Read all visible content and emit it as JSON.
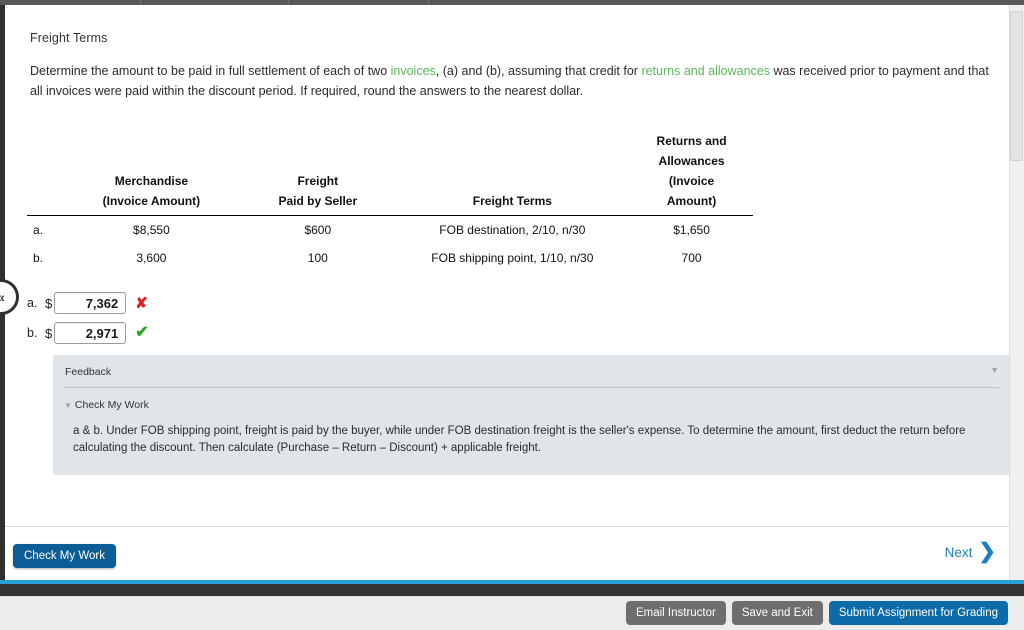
{
  "chrome": {
    "collapse_handle_icon": "chevron-left-double",
    "collapse_handle_glyph": "«"
  },
  "question": {
    "title": "Freight Terms",
    "body_part1": "Determine the amount to be paid in full settlement of each of two ",
    "link1": "invoices",
    "body_part2": ", (a) and (b), assuming that credit for ",
    "link2": "returns and allowances",
    "body_part3": " was received prior to payment and that all invoices were paid within the discount period. If required, round the answers to the nearest dollar."
  },
  "table": {
    "headers": {
      "label": "",
      "merchandise": "Merchandise\n(Invoice Amount)",
      "merchandise_l1": "Merchandise",
      "merchandise_l2": "(Invoice Amount)",
      "freight_l1": "Freight",
      "freight_l2": "Paid by Seller",
      "terms": "Freight Terms",
      "returns_l1": "Returns and",
      "returns_l2": "Allowances",
      "returns_l3": "(Invoice",
      "returns_l4": "Amount)"
    },
    "rows": [
      {
        "label": "a.",
        "merchandise": "$8,550",
        "freight": "$600",
        "terms": "FOB destination, 2/10, n/30",
        "returns": "$1,650"
      },
      {
        "label": "b.",
        "merchandise": "3,600",
        "freight": "100",
        "terms": "FOB shipping point, 1/10, n/30",
        "returns": "700"
      }
    ]
  },
  "answers": [
    {
      "letter": "a.",
      "currency": "$",
      "value": "7,362",
      "status": "incorrect",
      "mark": "✘"
    },
    {
      "letter": "b.",
      "currency": "$",
      "value": "2,971",
      "status": "correct",
      "mark": "✔"
    }
  ],
  "feedback": {
    "heading": "Feedback",
    "collapse_glyph": "▼",
    "check_my_work_label": "Check My Work",
    "check_my_work_tri": "▼",
    "text": "a & b. Under FOB shipping point, freight is paid by the buyer, while under FOB destination freight is the seller's expense. To determine the amount, first deduct the return before calculating the discount. Then calculate (Purchase – Return – Discount) + applicable freight."
  },
  "actions": {
    "check_my_work": "Check My Work",
    "next": "Next",
    "next_chevron": "❯"
  },
  "footer": {
    "email_instructor": "Email Instructor",
    "save_and_exit": "Save and Exit",
    "submit": "Submit Assignment for Grading"
  },
  "colors": {
    "accent_blue": "#0c5d96",
    "link_blue": "#1a7fc1",
    "glossary_green": "#5cb85c",
    "correct_green": "#27a327",
    "incorrect_red": "#e02020",
    "feedback_bg": "#dfe5e8",
    "footer_gray": "#6e6e6e",
    "rule_blue": "#2a9fd6"
  }
}
